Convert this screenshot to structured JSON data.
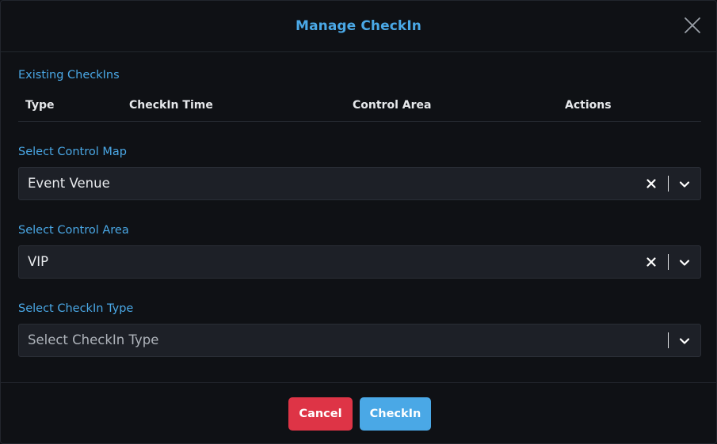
{
  "modal": {
    "title": "Manage CheckIn"
  },
  "existing": {
    "label": "Existing CheckIns",
    "columns": [
      "Type",
      "CheckIn Time",
      "Control Area",
      "Actions"
    ]
  },
  "control_map": {
    "label": "Select Control Map",
    "value": "Event Venue"
  },
  "control_area": {
    "label": "Select Control Area",
    "value": "VIP"
  },
  "checkin_type": {
    "label": "Select CheckIn Type",
    "placeholder": "Select CheckIn Type"
  },
  "footer": {
    "cancel_label": "Cancel",
    "checkin_label": "CheckIn"
  },
  "colors": {
    "accent": "#4aa8e6",
    "danger": "#de3446",
    "background": "#0f1115",
    "field": "#1d2027"
  },
  "icons": {
    "close": "close-icon",
    "clear": "clear-x-icon",
    "dropdown": "chevron-down-icon"
  }
}
